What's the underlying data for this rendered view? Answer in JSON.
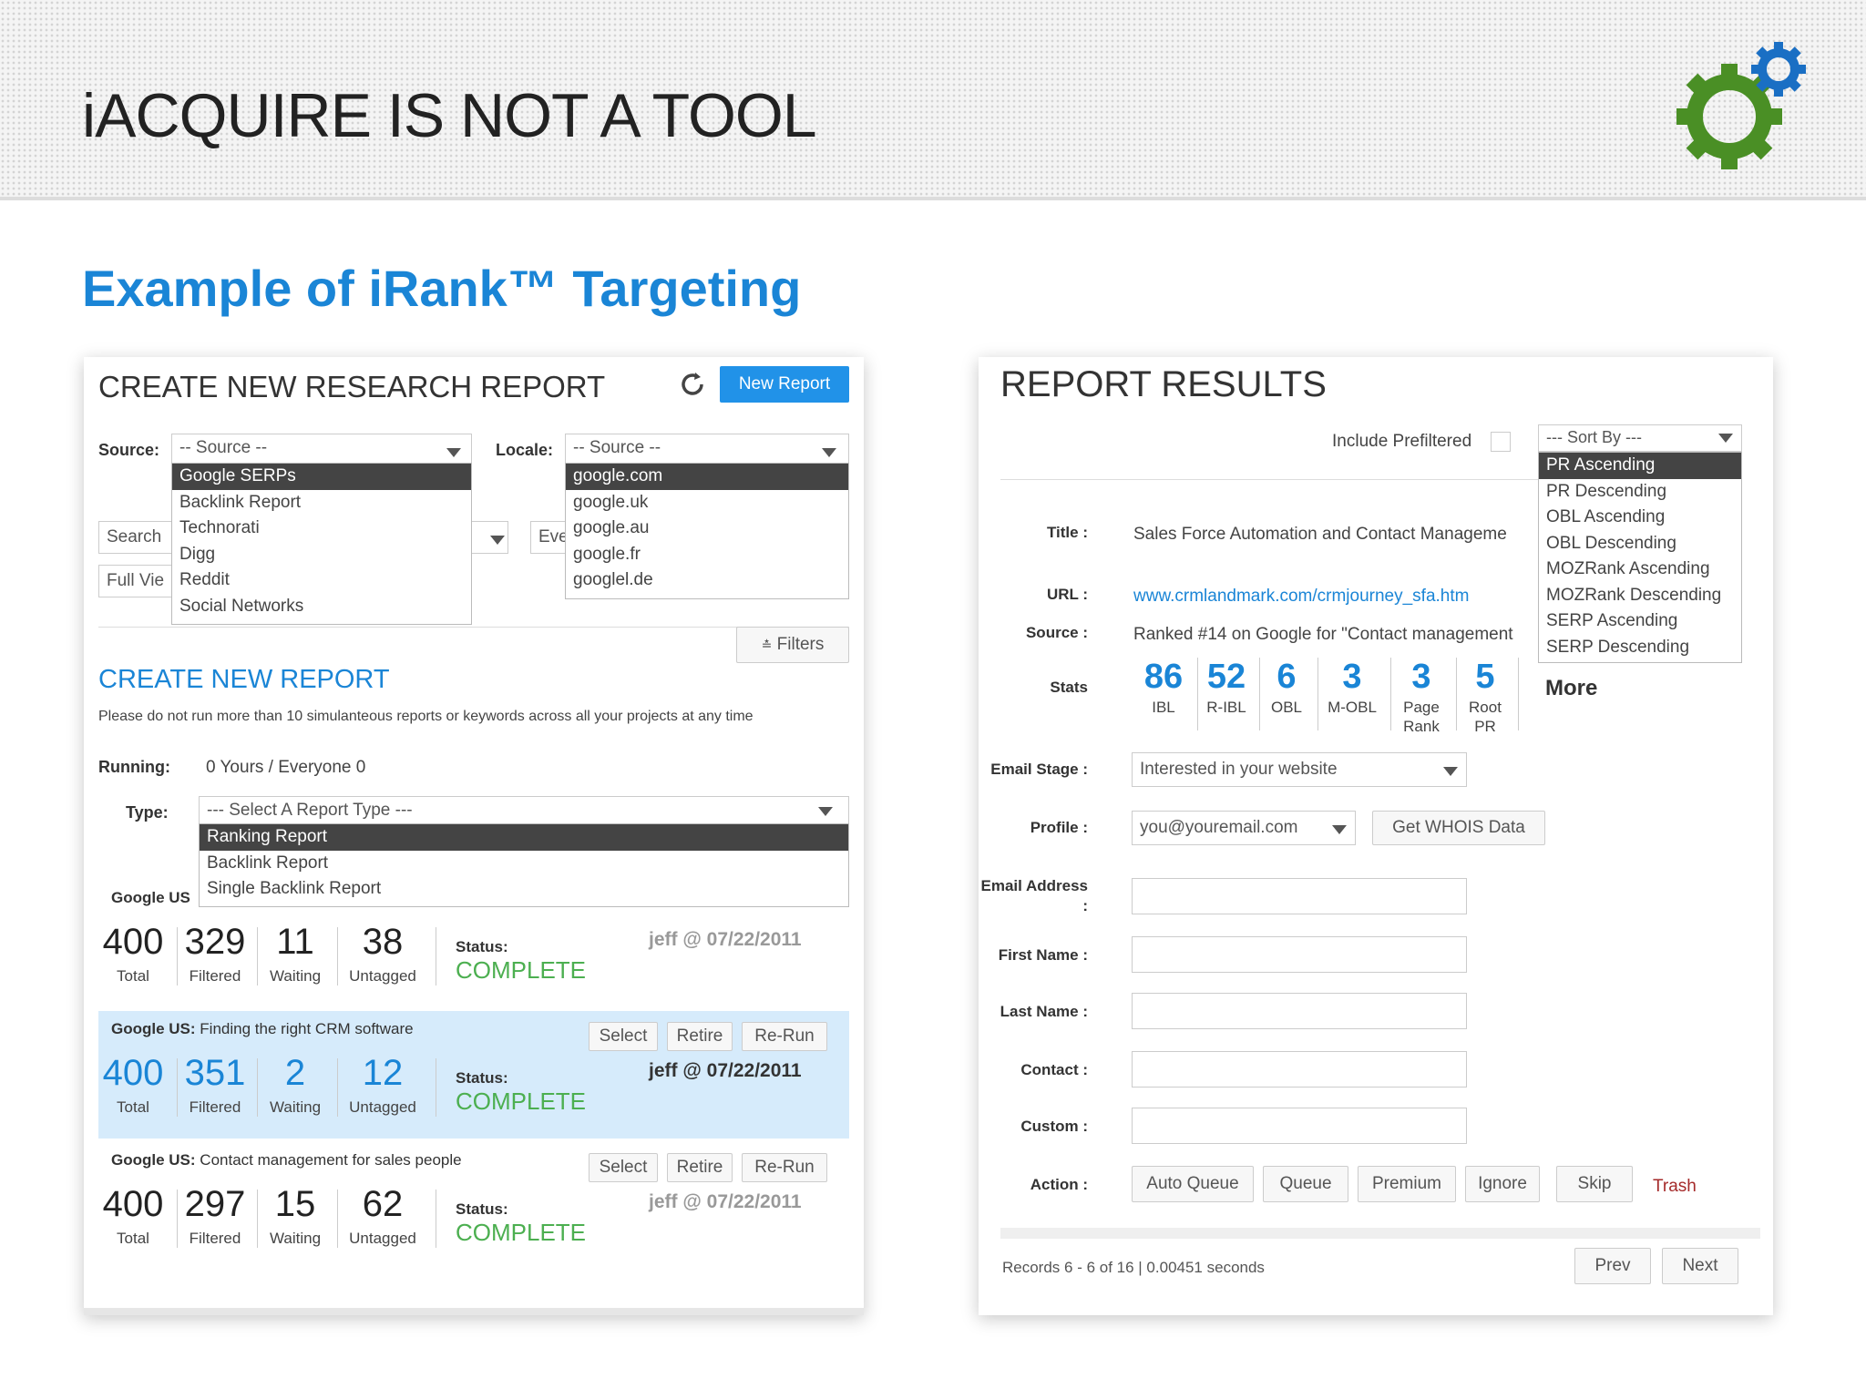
{
  "slide": {
    "title": "iACQUIRE IS NOT A TOOL",
    "subtitle": "Example of iRank™ Targeting",
    "accent_color": "#1a85d6",
    "logo_colors": [
      "#4a8f25",
      "#1a6fc4"
    ]
  },
  "left": {
    "header": "CREATE NEW RESEARCH REPORT",
    "refresh_icon": "refresh-icon",
    "new_report_label": "New Report",
    "source_label": "Source:",
    "source_value": "-- Source --",
    "source_options": [
      "Google SERPs",
      "Backlink Report",
      "Technorati",
      "Digg",
      "Reddit",
      "Social Networks"
    ],
    "locale_label": "Locale:",
    "locale_value": "-- Source --",
    "locale_options": [
      "google.com",
      "google.uk",
      "google.au",
      "google.fr",
      "googlel.de"
    ],
    "search_partial": "Search",
    "fullview_partial": "Full Vie",
    "every_partial": "Eve",
    "filters_label": "Filters",
    "section_title": "CREATE NEW REPORT",
    "notice": "Please do not run more than 10 simulanteous reports or keywords across all your projects at any time",
    "running_label": "Running:",
    "running_value": "0 Yours / Everyone 0",
    "type_label": "Type:",
    "type_value": "--- Select A Report Type ---",
    "type_options": [
      "Ranking Report",
      "Backlink Report",
      "Single Backlink Report"
    ],
    "reports": [
      {
        "engine": "Google US",
        "keyword": "",
        "total": "400",
        "filtered": "329",
        "waiting": "11",
        "untagged": "38",
        "status_label": "Status:",
        "status": "COMPLETE",
        "by": "jeff @ 07/22/2011"
      },
      {
        "engine": "Google US:",
        "keyword": "Finding the right CRM software",
        "total": "400",
        "filtered": "351",
        "waiting": "2",
        "untagged": "12",
        "status_label": "Status:",
        "status": "COMPLETE",
        "by": "jeff @ 07/22/2011"
      },
      {
        "engine": "Google US:",
        "keyword": "Contact management for sales people",
        "total": "400",
        "filtered": "297",
        "waiting": "15",
        "untagged": "62",
        "status_label": "Status:",
        "status": "COMPLETE",
        "by": "jeff @ 07/22/2011"
      }
    ],
    "count_labels": {
      "total": "Total",
      "filtered": "Filtered",
      "waiting": "Waiting",
      "untagged": "Untagged"
    },
    "row_buttons": {
      "select": "Select",
      "retire": "Retire",
      "rerun": "Re-Run"
    }
  },
  "right": {
    "header": "REPORT RESULTS",
    "include_prefiltered": "Include Prefiltered",
    "sort_value": "--- Sort By ---",
    "sort_options": [
      "PR Ascending",
      "PR Descending",
      "OBL Ascending",
      "OBL Descending",
      "MOZRank Ascending",
      "MOZRank Descending",
      "SERP Ascending",
      "SERP Descending"
    ],
    "title_label": "Title :",
    "title_value": "Sales Force Automation and Contact Manageme",
    "url_label": "URL :",
    "url_value": "www.crmlandmark.com/crmjourney_sfa.htm",
    "source_label": "Source :",
    "source_value": "Ranked #14 on Google for \"Contact management",
    "stats_label": "Stats",
    "stats": [
      {
        "value": "86",
        "label": "IBL"
      },
      {
        "value": "52",
        "label": "R-IBL"
      },
      {
        "value": "6",
        "label": "OBL"
      },
      {
        "value": "3",
        "label": "M-OBL"
      },
      {
        "value": "3",
        "label": "Page Rank"
      },
      {
        "value": "5",
        "label": "Root PR"
      }
    ],
    "more_label": "More",
    "email_stage_label": "Email Stage :",
    "email_stage_value": "Interested in your website",
    "profile_label": "Profile :",
    "profile_value": "you@youremail.com",
    "whois_label": "Get WHOIS Data",
    "email_address_label": "Email Address :",
    "first_name_label": "First Name :",
    "last_name_label": "Last Name :",
    "contact_label": "Contact :",
    "custom_label": "Custom :",
    "action_label": "Action :",
    "actions": [
      "Auto Queue",
      "Queue",
      "Premium",
      "Ignore",
      "Skip"
    ],
    "trash_label": "Trash",
    "records_text": "Records 6 - 6 of 16 | 0.00451 seconds",
    "prev_label": "Prev",
    "next_label": "Next"
  }
}
